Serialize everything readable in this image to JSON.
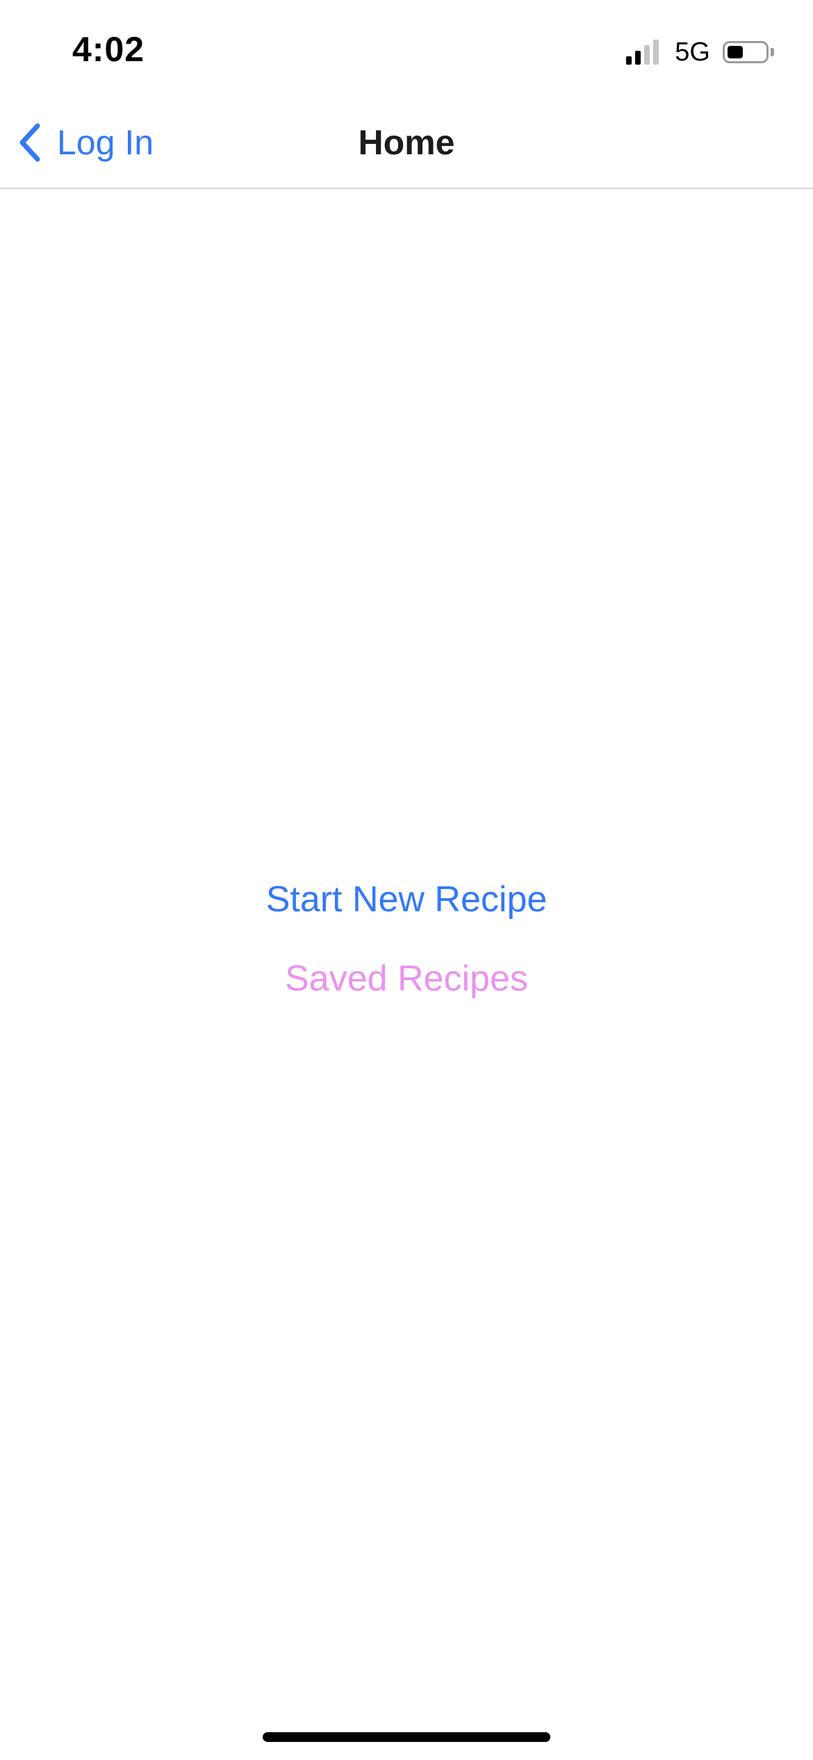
{
  "status_bar": {
    "time": "4:02",
    "network": "5G",
    "signal_bars_active": 2,
    "signal_bars_total": 4,
    "battery_level": 0.4
  },
  "nav": {
    "back_label": "Log In",
    "back_icon": "chevron-left-icon",
    "title": "Home"
  },
  "actions": {
    "start_new_recipe": "Start New Recipe",
    "saved_recipes": "Saved Recipes"
  },
  "colors": {
    "accent_blue": "#3478F6",
    "saved_pink": "#E993EE",
    "signal_active": "#000000",
    "signal_inactive": "#C4C4C6",
    "separator": "#D4D4D6"
  }
}
